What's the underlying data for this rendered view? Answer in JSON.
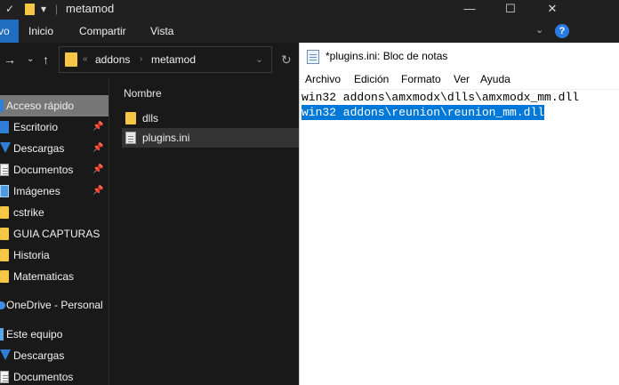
{
  "explorer": {
    "title": "metamod",
    "ribbon_tabs": [
      "vo",
      "Inicio",
      "Compartir",
      "Vista"
    ],
    "address": {
      "crumbs": [
        "addons",
        "metamod"
      ],
      "overflow": "«"
    },
    "file_list": {
      "column_header": "Nombre",
      "items": [
        {
          "name": "dlls",
          "type": "folder"
        },
        {
          "name": "plugins.ini",
          "type": "file"
        }
      ]
    },
    "sidebar": {
      "items": [
        {
          "label": "Acceso rápido",
          "icon": "star-icon"
        },
        {
          "label": "Escritorio",
          "icon": "desktop-icon",
          "pinned": true
        },
        {
          "label": "Descargas",
          "icon": "download-icon",
          "pinned": true
        },
        {
          "label": "Documentos",
          "icon": "documents-icon",
          "pinned": true
        },
        {
          "label": "Imágenes",
          "icon": "pictures-icon",
          "pinned": true
        },
        {
          "label": "cstrike",
          "icon": "folder-icon"
        },
        {
          "label": "GUIA CAPTURAS",
          "icon": "folder-icon"
        },
        {
          "label": "Historia",
          "icon": "folder-icon"
        },
        {
          "label": "Matematicas",
          "icon": "folder-icon"
        },
        {
          "label": "OneDrive - Personal",
          "icon": "onedrive-icon"
        },
        {
          "label": "Este equipo",
          "icon": "pc-icon"
        },
        {
          "label": "Descargas",
          "icon": "download-icon"
        },
        {
          "label": "Documentos",
          "icon": "documents-icon"
        }
      ]
    },
    "accent_color": "#1f6dc0"
  },
  "notepad": {
    "title": "*plugins.ini: Bloc de notas",
    "menu": [
      "Archivo",
      "Edición",
      "Formato",
      "Ver",
      "Ayuda"
    ],
    "lines": [
      "win32 addons\\amxmodx\\dlls\\amxmodx_mm.dll",
      "win32 addons\\reunion\\reunion_mm.dll"
    ],
    "selected_line": 1,
    "selection_color": "#0078d7"
  }
}
